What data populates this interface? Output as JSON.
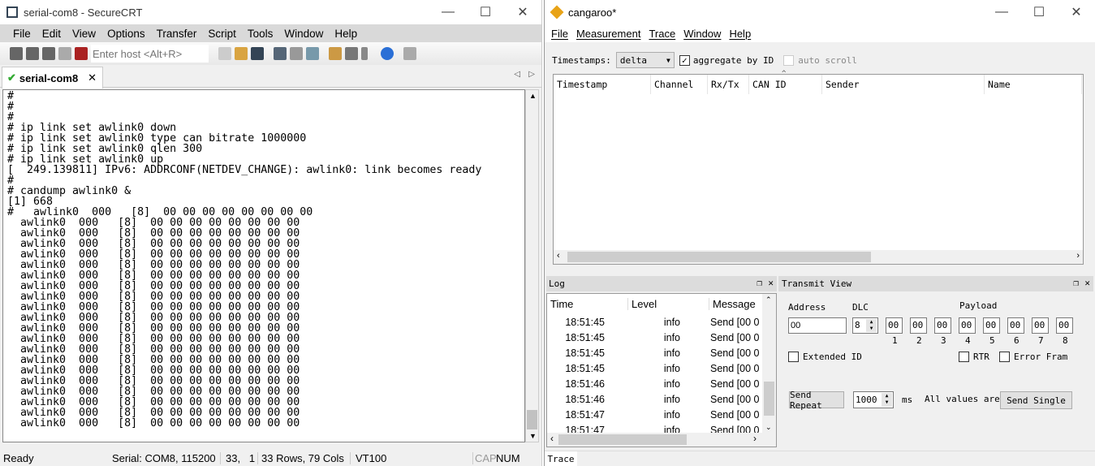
{
  "securecrt": {
    "title": "serial-com8 - SecureCRT",
    "menu": [
      "File",
      "Edit",
      "View",
      "Options",
      "Transfer",
      "Script",
      "Tools",
      "Window",
      "Help"
    ],
    "host_placeholder": "Enter host <Alt+R>",
    "tab_label": "serial-com8",
    "terminal_lines": [
      "#",
      "#",
      "#",
      "# ip link set awlink0 down",
      "# ip link set awlink0 type can bitrate 1000000",
      "# ip link set awlink0 qlen 300",
      "# ip link set awlink0 up",
      "[  249.139811] IPv6: ADDRCONF(NETDEV_CHANGE): awlink0: link becomes ready",
      "#",
      "# candump awlink0 &",
      "[1] 668",
      "#   awlink0  000   [8]  00 00 00 00 00 00 00 00"
    ],
    "dump_line": "  awlink0  000   [8]  00 00 00 00 00 00 00 00",
    "dump_count": 20,
    "status": {
      "ready": "Ready",
      "serial": "Serial: COM8, 115200",
      "cursor": "33,   1",
      "size": "33 Rows, 79 Cols",
      "emulation": "VT100",
      "cap": "CAP",
      "num": "NUM"
    }
  },
  "cangaroo": {
    "title": "cangaroo*",
    "menu": [
      "File",
      "Measurement",
      "Trace",
      "Window",
      "Help"
    ],
    "timestamps_label": "Timestamps:",
    "timestamps_value": "delta",
    "aggregate_label": "aggregate by ID",
    "aggregate_checked": true,
    "autoscroll_label": "auto scroll",
    "trace_columns": [
      "Timestamp",
      "Channel",
      "Rx/Tx",
      "CAN ID",
      "Sender",
      "Name"
    ],
    "log": {
      "title": "Log",
      "columns": [
        "Time",
        "Level",
        "Message"
      ],
      "rows": [
        [
          "18:51:45",
          "info",
          "Send [00 0"
        ],
        [
          "18:51:45",
          "info",
          "Send [00 0"
        ],
        [
          "18:51:45",
          "info",
          "Send [00 0"
        ],
        [
          "18:51:45",
          "info",
          "Send [00 0"
        ],
        [
          "18:51:46",
          "info",
          "Send [00 0"
        ],
        [
          "18:51:46",
          "info",
          "Send [00 0"
        ],
        [
          "18:51:47",
          "info",
          "Send [00 0"
        ],
        [
          "18:51:47",
          "info",
          "Send [00 0"
        ]
      ]
    },
    "transmit": {
      "title": "Transmit View",
      "address_label": "Address",
      "dlc_label": "DLC",
      "payload_label": "Payload",
      "address": "00",
      "dlc": "8",
      "payload": [
        "00",
        "00",
        "00",
        "00",
        "00",
        "00",
        "00",
        "00"
      ],
      "payload_idx": [
        "1",
        "2",
        "3",
        "4",
        "5",
        "6",
        "7",
        "8"
      ],
      "extended_id": "Extended ID",
      "rtr": "RTR",
      "error_frame": "Error Fram",
      "send_repeat": "Send Repeat",
      "interval": "1000",
      "ms": "ms",
      "all_values": "All values are ]",
      "send_single": "Send Single"
    },
    "bottom_tab": "Trace"
  }
}
